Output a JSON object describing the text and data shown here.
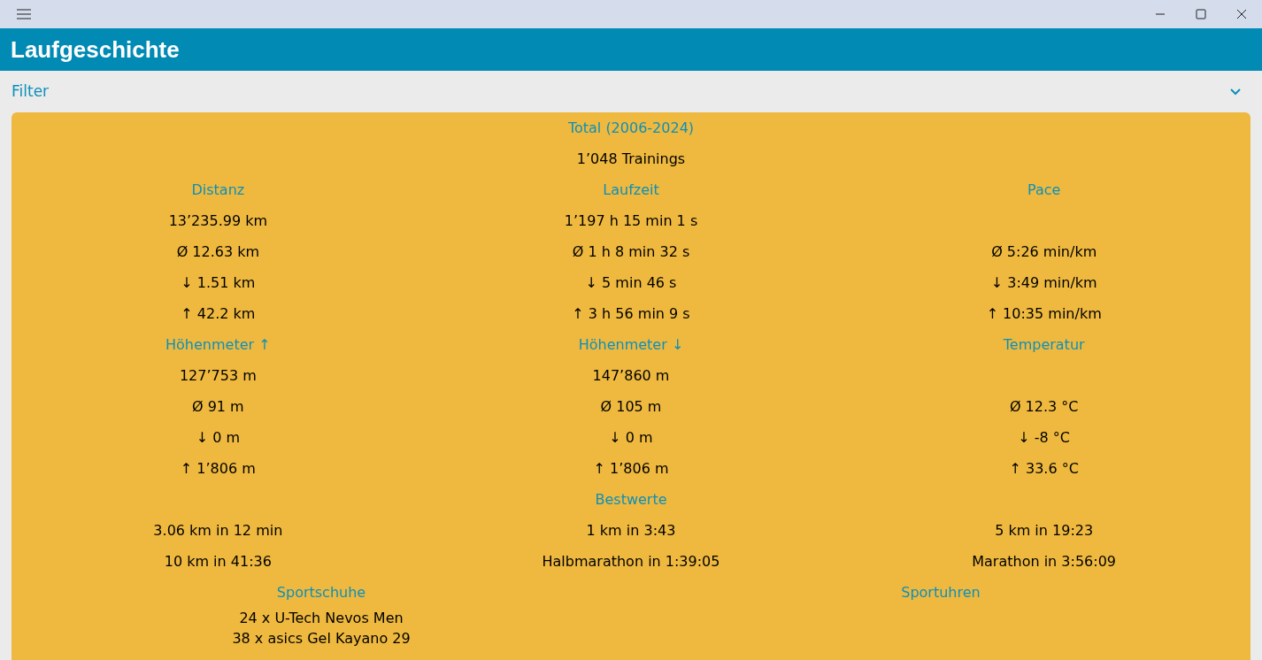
{
  "window": {
    "title": "Laufgeschichte"
  },
  "filter": {
    "label": "Filter",
    "expanded": false
  },
  "summary": {
    "heading": "Total (2006-2024)",
    "trainings": "1’048 Trainings",
    "groups": [
      {
        "columns": [
          {
            "heading": "Distanz",
            "total": "13’235.99 km",
            "average": "Ø 12.63 km",
            "min": "↓ 1.51 km",
            "max": "↑ 42.2 km"
          },
          {
            "heading": "Laufzeit",
            "total": "1’197 h 15 min 1 s",
            "average": "Ø 1 h 8 min 32 s",
            "min": "↓ 5 min 46 s",
            "max": "↑ 3 h 56 min 9 s"
          },
          {
            "heading": "Pace",
            "average": "Ø 5:26 min/km",
            "min": "↓ 3:49 min/km",
            "max": "↑ 10:35 min/km"
          }
        ]
      },
      {
        "columns": [
          {
            "heading": "Höhenmeter ↑",
            "total": "127’753 m",
            "average": "Ø 91 m",
            "min": "↓ 0 m",
            "max": "↑ 1’806 m"
          },
          {
            "heading": "Höhenmeter ↓",
            "total": "147’860 m",
            "average": "Ø 105 m",
            "min": "↓ 0 m",
            "max": "↑ 1’806 m"
          },
          {
            "heading": "Temperatur",
            "average": "Ø 12.3 °C",
            "min": "↓ -8 °C",
            "max": "↑ 33.6 °C"
          }
        ]
      }
    ],
    "bests": {
      "heading": "Bestwerte",
      "items": [
        "3.06 km in 12 min",
        "1 km in 3:43",
        "5 km in 19:23",
        "10 km in 41:36",
        "Halbmarathon in 1:39:05",
        "Marathon in 3:56:09"
      ]
    },
    "equipment": [
      {
        "heading": "Sportschuhe",
        "items": [
          "24 x U-Tech Nevos Men",
          "38 x asics Gel Kayano 29"
        ]
      },
      {
        "heading": "Sportuhren"
      }
    ]
  }
}
